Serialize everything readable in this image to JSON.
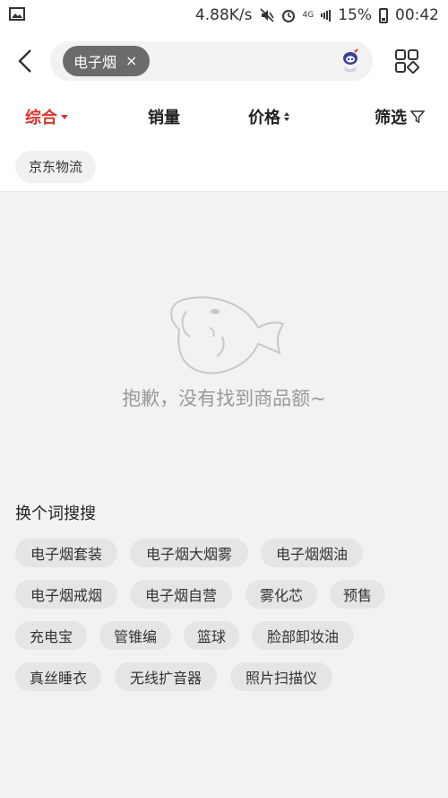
{
  "status_bar": {
    "speed": "4.88K/s",
    "network": "4G",
    "battery": "15%",
    "time": "00:42"
  },
  "search": {
    "chip_label": "电子烟",
    "chip_close": "×"
  },
  "sort_tabs": [
    {
      "label": "综合"
    },
    {
      "label": "销量"
    },
    {
      "label": "价格"
    },
    {
      "label": "筛选"
    }
  ],
  "filters": [
    {
      "label": "京东物流"
    }
  ],
  "empty_state": {
    "message": "抱歉，没有找到商品额~"
  },
  "suggestions": {
    "title": "换个词搜搜",
    "tags": [
      {
        "label": "电子烟套装"
      },
      {
        "label": "电子烟大烟雾"
      },
      {
        "label": "电子烟烟油"
      },
      {
        "label": "电子烟戒烟"
      },
      {
        "label": "电子烟自营"
      },
      {
        "label": "雾化芯"
      },
      {
        "label": "预售"
      },
      {
        "label": "充电宝"
      },
      {
        "label": "管锥编"
      },
      {
        "label": "篮球"
      },
      {
        "label": "脸部卸妆油"
      },
      {
        "label": "真丝睡衣"
      },
      {
        "label": "无线扩音器"
      },
      {
        "label": "照片扫描仪"
      }
    ]
  },
  "colors": {
    "accent": "#d6362e",
    "chip_bg": "#6b6b6b",
    "page_bg": "#f2f2f2",
    "tag_bg": "#e5e5e5"
  },
  "icons": [
    "image-icon",
    "mute-icon",
    "alarm-icon",
    "signal-icon",
    "battery-icon",
    "back-icon",
    "robot-icon",
    "grid-icon",
    "filter-icon",
    "fish-icon"
  ]
}
